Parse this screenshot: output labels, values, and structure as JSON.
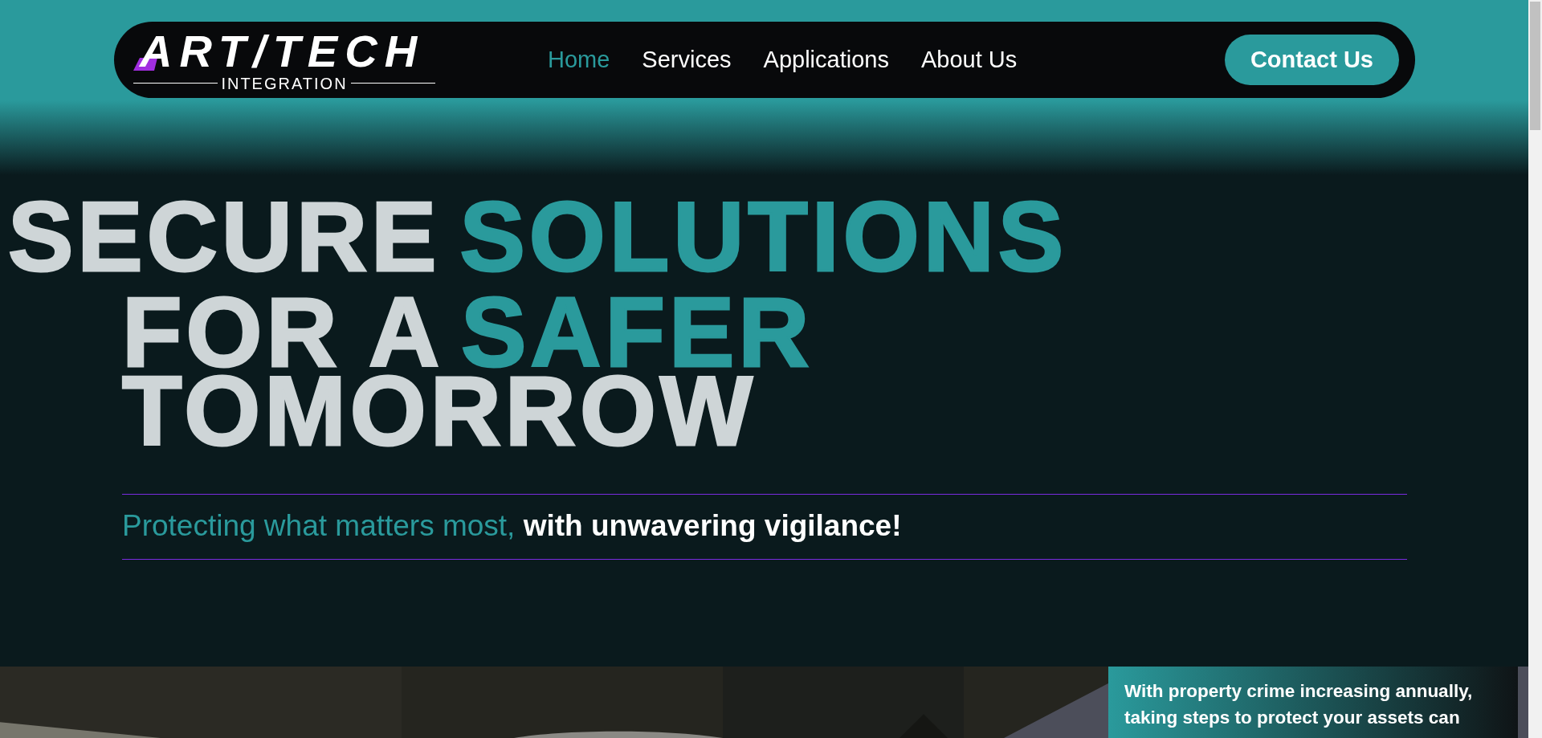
{
  "logo": {
    "title": "ART/TECH",
    "subtitle": "INTEGRATION"
  },
  "nav": [
    {
      "label": "Home",
      "selected": true
    },
    {
      "label": "Services",
      "selected": false
    },
    {
      "label": "Applications",
      "selected": false
    },
    {
      "label": "About Us",
      "selected": false
    }
  ],
  "contact_button": "Contact Us",
  "hero": {
    "lines": [
      [
        {
          "text": "SECURE",
          "accent": false
        },
        {
          "text": "SOLUTIONS",
          "accent": true
        }
      ],
      [
        {
          "text": "FOR A",
          "accent": false
        },
        {
          "text": "SAFER",
          "accent": true
        }
      ],
      [
        {
          "text": "TOMORROW",
          "accent": false
        }
      ]
    ],
    "tagline": "Protecting what matters most, **with unwavering vigilance!**"
  },
  "feature": {
    "text": "With property crime increasing annually, taking steps to protect your assets can"
  }
}
